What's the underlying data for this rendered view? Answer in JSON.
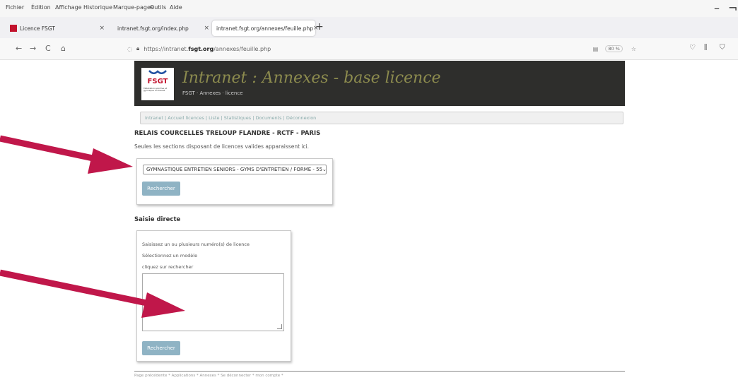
{
  "menubar": {
    "items": [
      "Fichier",
      "Édition",
      "Affichage",
      "Historique",
      "Marque-pages",
      "Outils",
      "Aide"
    ],
    "minimize": "–",
    "restore": "¬"
  },
  "tabs": [
    {
      "label": "Licence FSGT",
      "close": "×"
    },
    {
      "label": "intranet.fsgt.org/index.php",
      "close": "×"
    },
    {
      "label": "intranet.fsgt.org/annexes/feuille.php",
      "close": "×"
    }
  ],
  "new_tab": "+",
  "navbar": {
    "back": "←",
    "forward": "→",
    "reload": "C",
    "home": "⌂",
    "url_prefix": "https://intranet.",
    "url_host": "fsgt.org",
    "url_path": "/annexes/feuille.php",
    "zoom": "80 %"
  },
  "page": {
    "title": "Intranet : Annexes - base licence",
    "breadcrumb": "FSGT · Annexes · licence",
    "logo_text": "FSGT",
    "logo_subtitle": "Fédération sportive et gymnique du travail",
    "subnav": "Intranet | Accueil licences | Liste | Statistiques | Documents | Déconnexion",
    "club_name": "RELAIS COURCELLES TRELOUP FLANDRE - RCTF - PARIS",
    "notice": "Seules les sections disposant de licences valides apparaissent ici.",
    "section_select": "GYMNASTIQUE ENTRETIEN SENIORS - GYMS D'ENTRETIEN / FORME - 55",
    "search_button": "Rechercher",
    "direct_title": "Saisie directe",
    "direct_instructions": [
      "Saisissez un ou plusieurs numéro(s) de licence",
      "Sélectionnez un modèle",
      "cliquez sur rechercher"
    ],
    "direct_search_button": "Rechercher",
    "footer": "Page précédente * Applications * Annexes * Se déconnecter * mon compte *"
  },
  "colors": {
    "banner": "#2e2e2c",
    "title": "#8c8b4e",
    "button": "#8fb3c4",
    "arrow": "#c0174a"
  }
}
